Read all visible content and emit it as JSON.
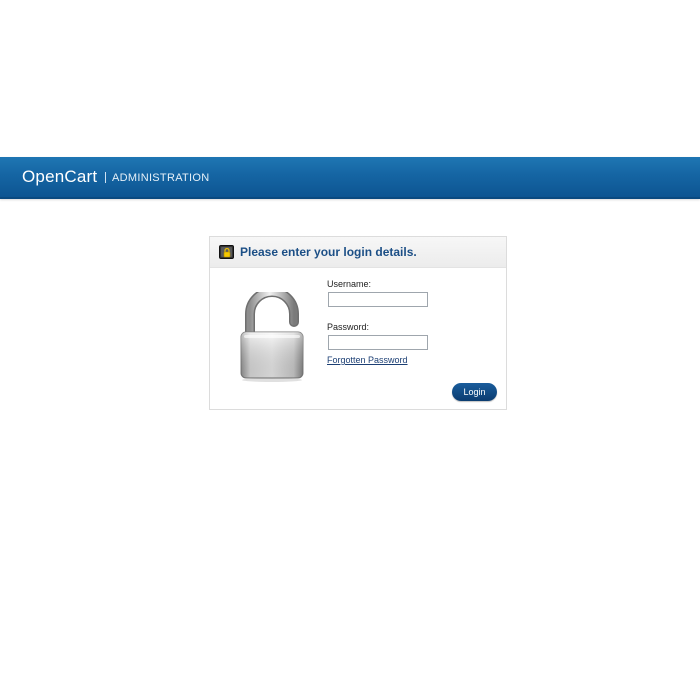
{
  "header": {
    "brand": "OpenCart",
    "subtitle": "ADMINISTRATION",
    "bar_color": "#1565a3"
  },
  "login": {
    "title": "Please enter your login details.",
    "title_icon": "lock-key-icon",
    "illustration_icon": "padlock-icon",
    "username_label": "Username:",
    "username_value": "",
    "password_label": "Password:",
    "password_value": "",
    "forgot_label": "Forgotten Password",
    "button_label": "Login",
    "button_color": "#0b3c70"
  }
}
